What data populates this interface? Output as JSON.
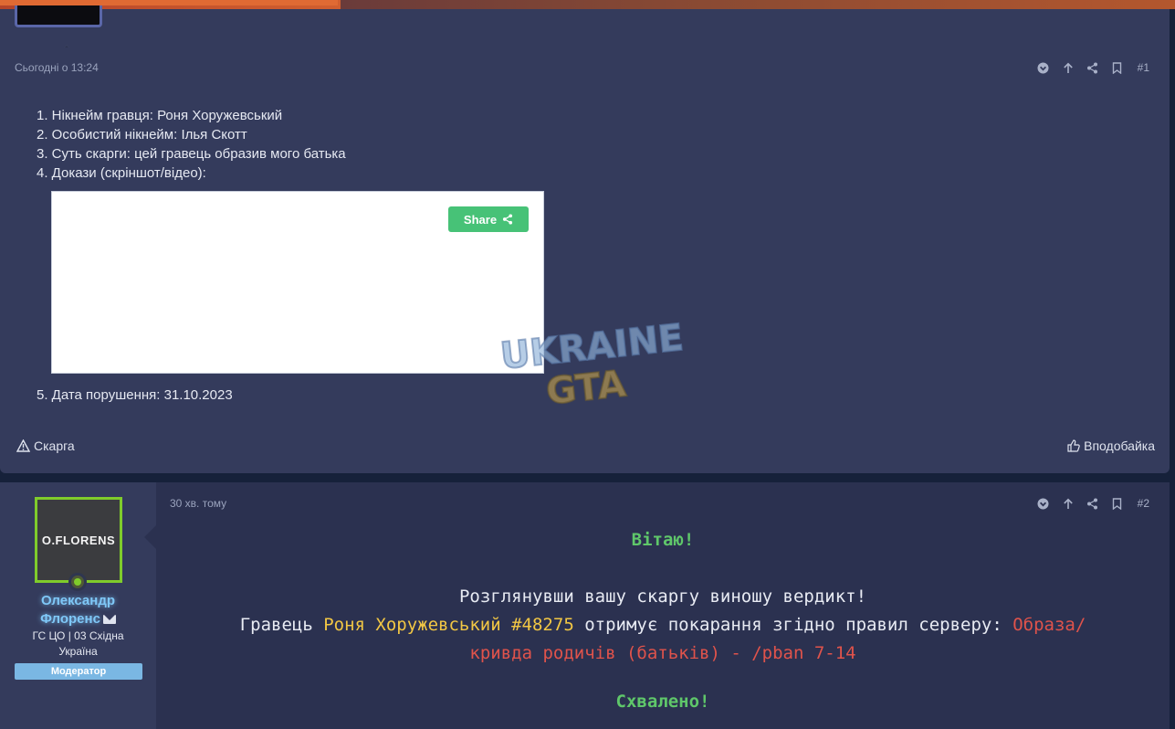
{
  "post1": {
    "timestamp": "Сьогодні о 13:24",
    "post_number": "#1",
    "items": [
      "1. Нікнейм гравця: Роня Хоружевський",
      "2. Особистий нікнейм: Ілья Скотт",
      "3. Суть скарги: цей гравець образив мого батька",
      "4. Докази (скріншот/відео):"
    ],
    "share_label": "Share",
    "item5": "5. Дата порушення: 31.10.2023",
    "report_label": "Скарга",
    "like_label": "Вподобайка"
  },
  "watermark": {
    "line1": "UKRAINE",
    "line2": "GTA"
  },
  "post2": {
    "timestamp": "30 хв. тому",
    "post_number": "#2",
    "author": {
      "avatar_text": "O.FLORENS",
      "name_line1": "Олександр",
      "name_line2": "Флоренс",
      "title_line1": "ГС ЦО | 03 Східна",
      "title_line2": "Україна",
      "badge": "Модератор"
    },
    "greeting": "Вітаю!",
    "line1": "Розглянувши вашу скаргу виношу вердикт!",
    "line2_prefix": "Гравець ",
    "line2_player": "Роня Хоружевський #48275",
    "line2_middle": " отримує покарання згідно правил серверу: ",
    "line2_reason_a": "Образа/",
    "line3_reason_b": "кривда родичів (батьків) - /pban 7-14",
    "approved": "Схвалено!"
  },
  "colors": {
    "accent_green": "#5fc76a",
    "player_yellow": "#f2c744",
    "reason_red": "#e0534b",
    "username_blue": "#7fc8f8",
    "share_green": "#47c277"
  }
}
